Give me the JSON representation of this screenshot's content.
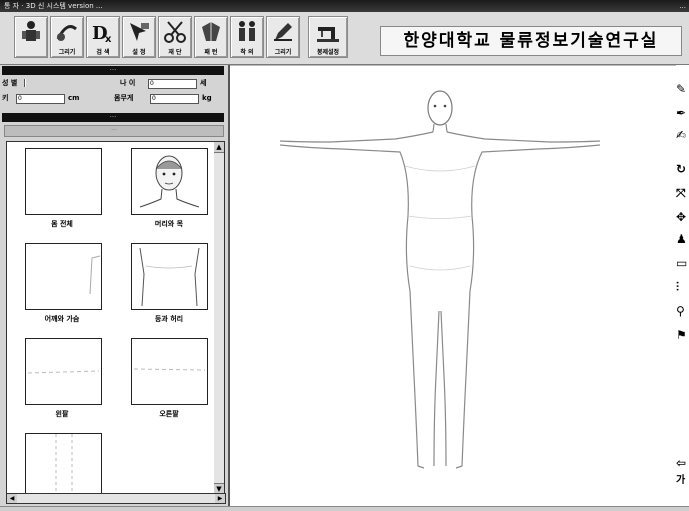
{
  "window": {
    "title": "통 자 · 3D 신 시스템 version ...",
    "caption_right": "..."
  },
  "toolbar": {
    "buttons": [
      {
        "icon": "person-icon",
        "label": ""
      },
      {
        "icon": "tape-measure-icon",
        "label": "그리기"
      },
      {
        "icon": "dx-icon",
        "label": "검 색"
      },
      {
        "icon": "cursor-icon",
        "label": "설 정"
      },
      {
        "icon": "scissors-icon",
        "label": "재 단"
      },
      {
        "icon": "bodice-icon",
        "label": "패 턴"
      },
      {
        "icon": "suit-icon",
        "label": "착 의"
      },
      {
        "icon": "edit-icon",
        "label": "그리기"
      },
      {
        "icon": "sewing-machine-icon",
        "label": "봉제설정"
      }
    ],
    "lab_name": "한양대학교 물류정보기술연구실"
  },
  "left_panel": {
    "header": "···",
    "fields": {
      "gender_label": "성 별",
      "age_label": "나 이",
      "age_value": "0",
      "age_unit": "세",
      "height_label": "키",
      "height_value": "0",
      "height_unit": "cm",
      "weight_label": "몸무게",
      "weight_value": "0",
      "weight_unit": "kg"
    },
    "section_bar": "···",
    "sub_bar": "···",
    "parts": [
      {
        "name": "몸 전체"
      },
      {
        "name": "머리와 목"
      },
      {
        "name": "어깨와 가슴"
      },
      {
        "name": "등과 허리"
      },
      {
        "name": "왼팔"
      },
      {
        "name": "오른팔"
      },
      {
        "name": ""
      }
    ]
  },
  "right_tools": [
    {
      "icon": "pencil-icon",
      "glyph": "✎"
    },
    {
      "icon": "pen-icon",
      "glyph": "✒"
    },
    {
      "icon": "brush-icon",
      "glyph": "✍"
    },
    {
      "icon": "rotate-icon",
      "glyph": "↻"
    },
    {
      "icon": "fit-icon",
      "glyph": "⤧"
    },
    {
      "icon": "move-icon",
      "glyph": "✥"
    },
    {
      "icon": "figure-icon",
      "glyph": "♟"
    },
    {
      "icon": "page-icon",
      "glyph": "▭"
    },
    {
      "icon": "mirror-icon",
      "glyph": "⫶"
    },
    {
      "icon": "measure-icon",
      "glyph": "⚲"
    },
    {
      "icon": "dress-icon",
      "glyph": "⚑"
    }
  ],
  "right_tools_bottom": [
    {
      "icon": "back-arrow-icon",
      "glyph": "⇦"
    },
    {
      "icon": "text-icon",
      "glyph": "가"
    }
  ]
}
